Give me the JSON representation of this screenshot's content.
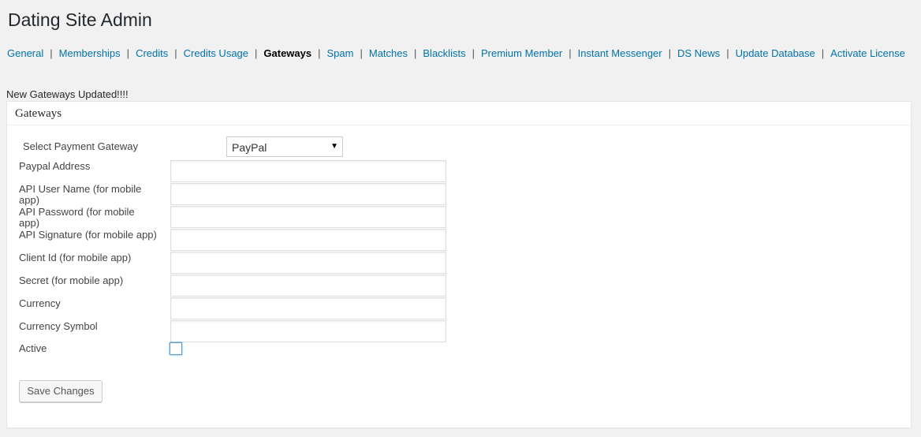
{
  "header": {
    "title": "Dating Site Admin"
  },
  "subnav": {
    "items": [
      {
        "label": "General",
        "current": false
      },
      {
        "label": "Memberships",
        "current": false
      },
      {
        "label": "Credits",
        "current": false
      },
      {
        "label": "Credits Usage",
        "current": false
      },
      {
        "label": "Gateways",
        "current": true
      },
      {
        "label": "Spam",
        "current": false
      },
      {
        "label": "Matches",
        "current": false
      },
      {
        "label": "Blacklists",
        "current": false
      },
      {
        "label": "Premium Member",
        "current": false
      },
      {
        "label": "Instant Messenger",
        "current": false
      },
      {
        "label": "DS News",
        "current": false
      },
      {
        "label": "Update Database",
        "current": false
      },
      {
        "label": "Activate License",
        "current": false
      }
    ],
    "separator": "|"
  },
  "notice": "New Gateways Updated!!!!",
  "panel": {
    "title": "Gateways",
    "gateway": {
      "label": "Select Payment Gateway",
      "selected": "PayPal",
      "arrow": "▼"
    },
    "fields": [
      {
        "name": "paypal-address",
        "label": "Paypal Address",
        "value": ""
      },
      {
        "name": "api-user-name",
        "label": "API User Name (for mobile app)",
        "value": ""
      },
      {
        "name": "api-password",
        "label": "API Password (for mobile app)",
        "value": ""
      },
      {
        "name": "api-signature",
        "label": "API Signature (for mobile app)",
        "value": ""
      },
      {
        "name": "client-id",
        "label": "Client Id (for mobile app)",
        "value": ""
      },
      {
        "name": "secret",
        "label": "Secret (for mobile app)",
        "value": ""
      },
      {
        "name": "currency",
        "label": "Currency",
        "value": ""
      },
      {
        "name": "currency-symbol",
        "label": "Currency Symbol",
        "value": ""
      }
    ],
    "active": {
      "label": "Active",
      "checked": false
    },
    "save_label": "Save Changes"
  },
  "colors": {
    "link": "#0073aa",
    "background": "#f1f1f1",
    "panel": "#ffffff",
    "focus": "#5b9dd9"
  }
}
